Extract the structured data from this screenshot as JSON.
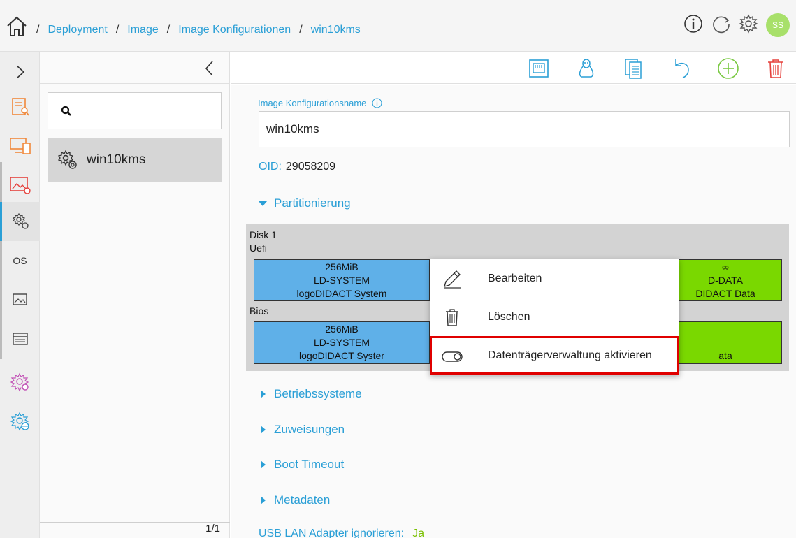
{
  "header": {
    "breadcrumb": [
      "Deployment",
      "Image",
      "Image Konfigurationen",
      "win10kms"
    ],
    "separator": "/",
    "avatar_initials": "SS"
  },
  "rail": {
    "os_label": "OS"
  },
  "list": {
    "items": [
      {
        "label": "win10kms"
      }
    ],
    "pager": "1/1"
  },
  "form": {
    "name_label": "Image Konfigurationsname",
    "name_value": "win10kms",
    "oid_label": "OID:",
    "oid_value": "29058209",
    "sections": {
      "partitionierung": "Partitionierung",
      "betriebssysteme": "Betriebssysteme",
      "zuweisungen": "Zuweisungen",
      "boot_timeout": "Boot Timeout",
      "metadaten": "Metadaten"
    },
    "usb_label": "USB LAN Adapter ignorieren:",
    "usb_value": "Ja"
  },
  "partitions": {
    "disk": "Disk 1",
    "uefi_label": "Uefi",
    "bios_label": "Bios",
    "uefi_system": {
      "size": "256MiB",
      "name": "LD-SYSTEM",
      "desc": "logoDIDACT System"
    },
    "uefi_data": {
      "size": "∞",
      "name": "D-DATA",
      "desc": "DIDACT Data"
    },
    "bios_system": {
      "size": "256MiB",
      "name": "LD-SYSTEM",
      "desc": "logoDIDACT Syster"
    },
    "bios_data": {
      "desc": "ata"
    }
  },
  "context_menu": {
    "edit": "Bearbeiten",
    "delete": "Löschen",
    "activate": "Datenträgerverwaltung aktivieren"
  },
  "colors": {
    "accent": "#2a9fd6",
    "partition_blue": "#5fb0e8",
    "partition_green": "#7ad800",
    "highlight": "#e00000",
    "orange_icon": "#f0883a",
    "green_add": "#7ac943",
    "red_delete": "#e5413c"
  }
}
